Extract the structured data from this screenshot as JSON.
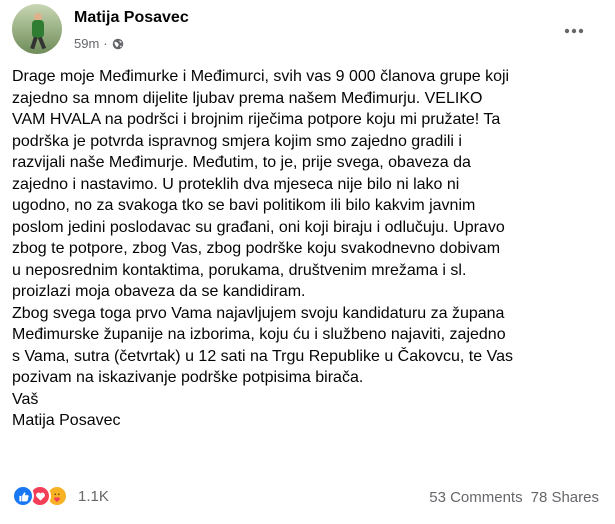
{
  "post": {
    "author": "Matija Posavec",
    "time": "59m",
    "separator": "·",
    "audience_icon": "globe-icon",
    "more_icon": "more-horizontal-icon",
    "lines": [
      "Drage moje Međimurke i Međimurci, svih vas 9 000 članova grupe koji",
      "zajedno sa mnom dijelite ljubav prema našem Međimurju. VELIKO",
      "VAM HVALA na podršci i brojnim riječima potpore koju mi pružate! Ta",
      "podrška je potvrda ispravnog smjera kojim smo zajedno gradili i",
      "razvijali naše Međimurje. Međutim, to je, prije svega, obaveza da",
      "zajedno i nastavimo. U proteklih dva mjeseca nije bilo ni lako ni",
      "ugodno, no za svakoga tko se bavi politikom ili bilo kakvim javnim",
      "poslom jedini poslodavac su građani, oni koji biraju i odlučuju. Upravo",
      "zbog te potpore, zbog Vas, zbog podrške koju svakodnevno dobivam",
      "u neposrednim kontaktima, porukama, društvenim mrežama i sl.",
      "proizlazi moja obaveza da se kandidiram.",
      "Zbog svega toga prvo Vama najavljujem svoju kandidaturu za župana",
      "Međimurske županije na izborima, koju ću i službeno najaviti, zajedno",
      "s Vama, sutra (četvrtak) u 12 sati na Trgu Republike u Čakovcu, te Vas",
      "pozivam na iskazivanje podrške potpisima birača.",
      "Vaš",
      "Matija Posavec"
    ]
  },
  "footer": {
    "reactions": [
      "like-icon",
      "love-icon",
      "care-icon"
    ],
    "reaction_count": "1.1K",
    "comments": "53 Comments",
    "shares": "78 Shares"
  },
  "colors": {
    "text": "#050505",
    "secondary": "#65676b",
    "like": "#1877f2",
    "love": "#f33e58",
    "care": "#f7b125"
  }
}
